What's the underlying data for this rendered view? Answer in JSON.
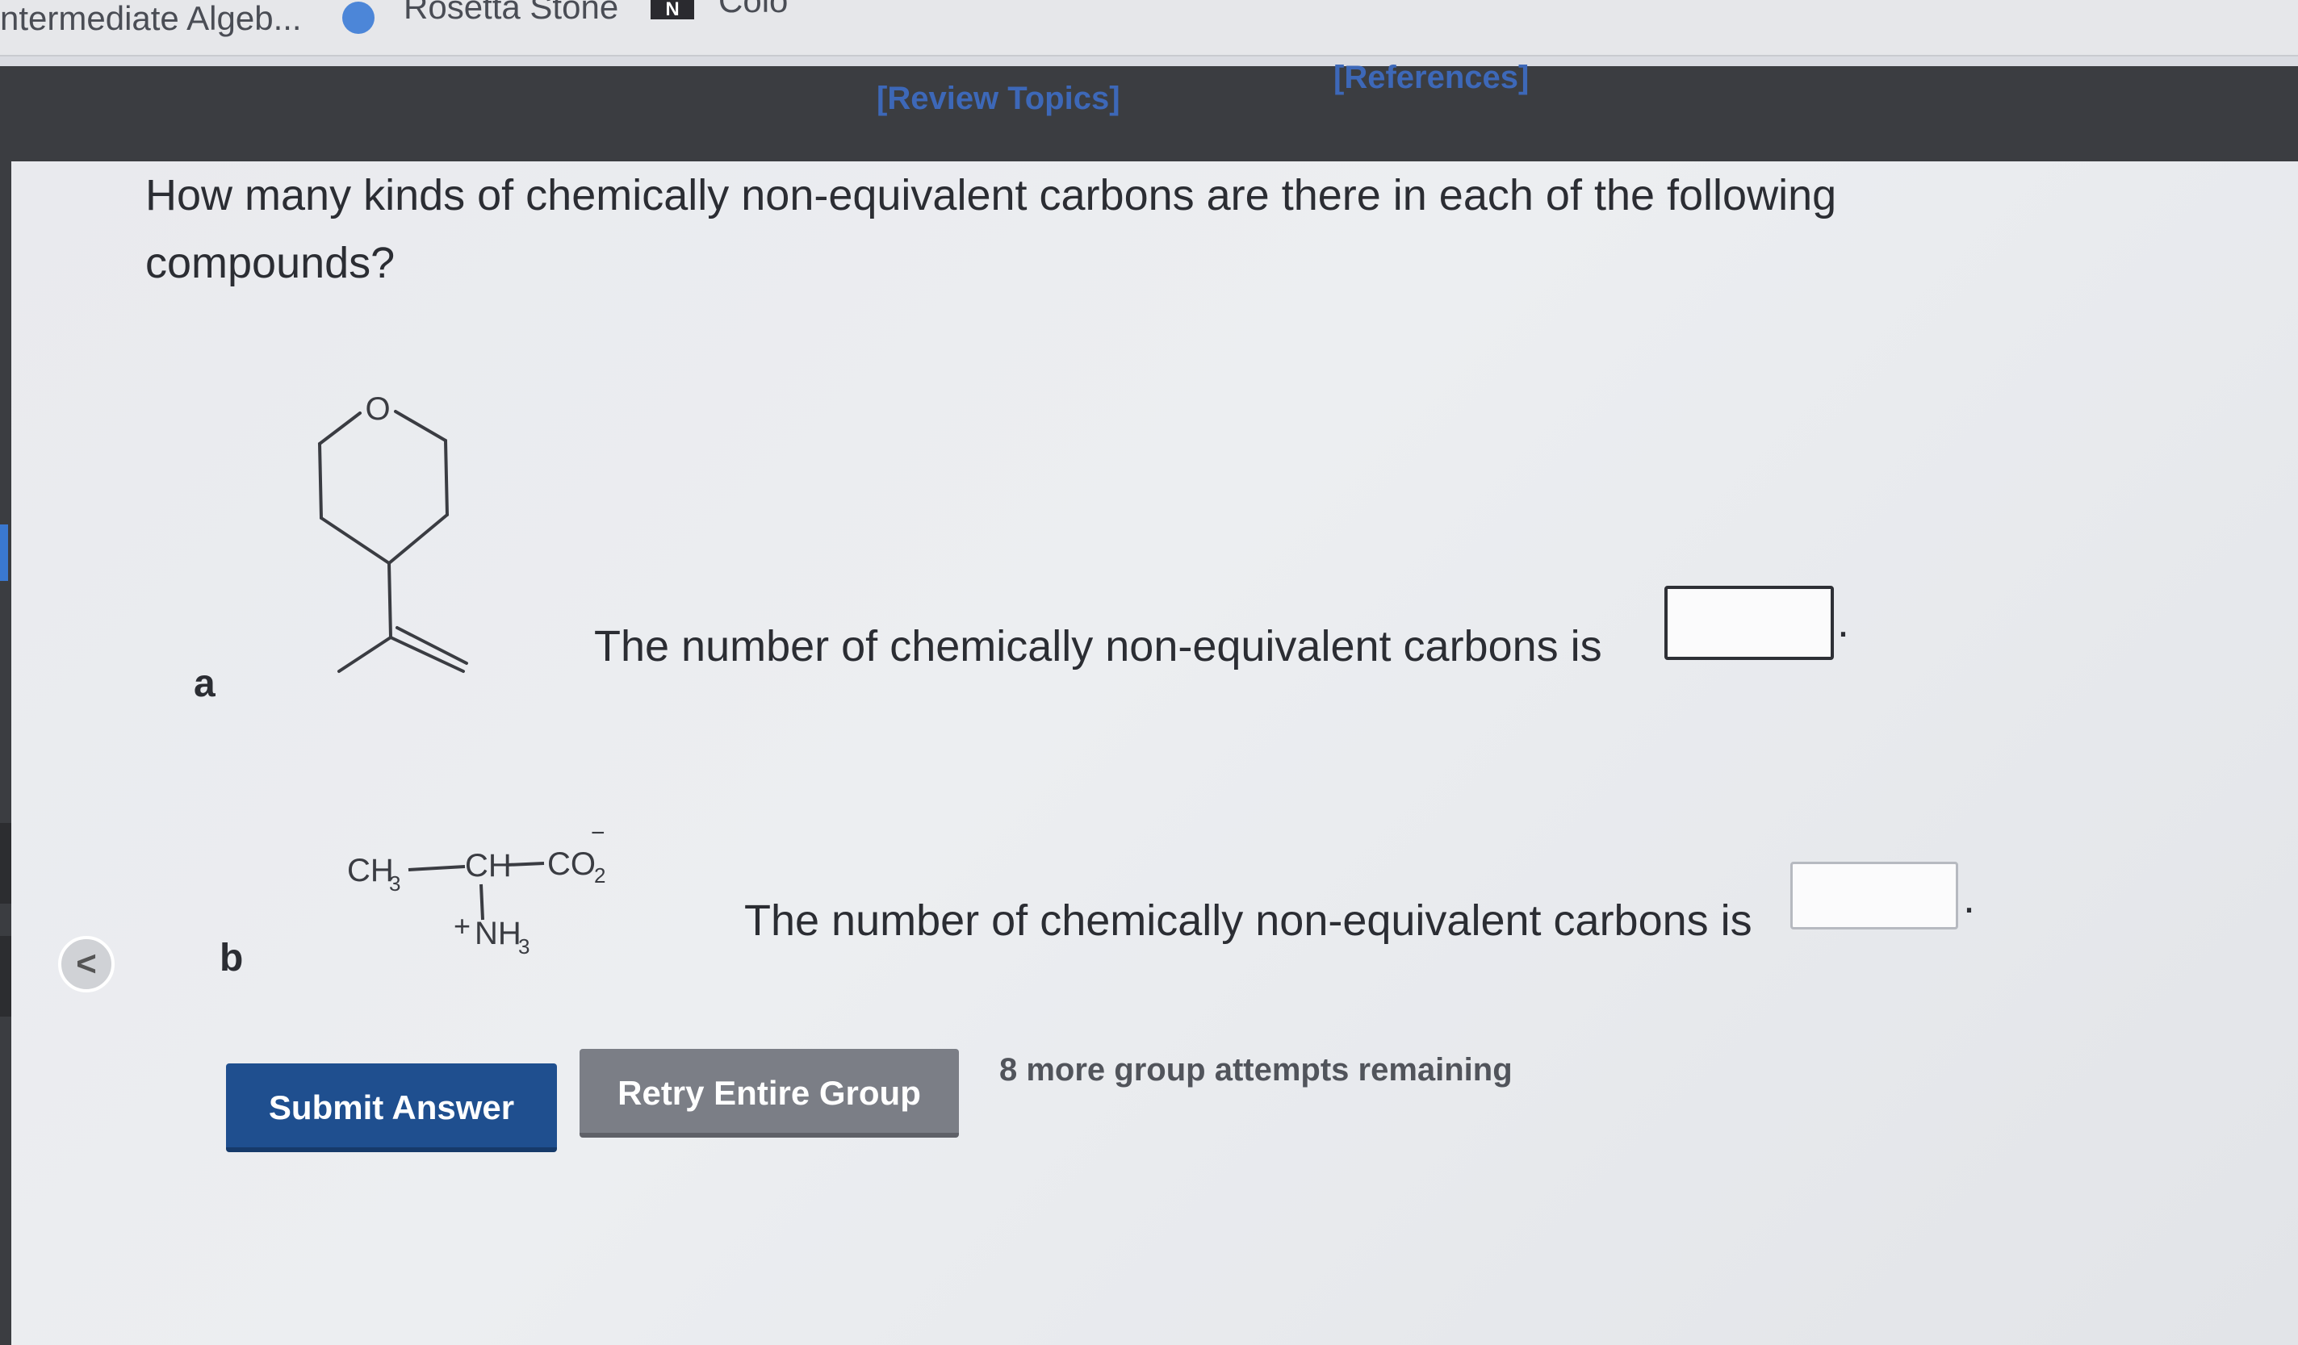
{
  "bookmarks": {
    "item1": "ntermediate Algeb...",
    "item2": "Rosetta Stone",
    "item3": "Colo"
  },
  "header": {
    "review_topics": "[Review Topics]",
    "references": "[References]"
  },
  "question": {
    "text": "How many kinds of chemically non-equivalent carbons are there in each of the following compounds?"
  },
  "parts": [
    {
      "label": "a",
      "prompt": "The number of chemically non-equivalent carbons is",
      "answer": "",
      "period": "."
    },
    {
      "label": "b",
      "prompt": "The number of chemically non-equivalent carbons is",
      "answer": "",
      "period": "."
    }
  ],
  "molecule_a": {
    "oxygen": "O"
  },
  "molecule_b": {
    "ch3": "CH",
    "ch3_sub": "3",
    "ch": "CH",
    "co2": "CO",
    "co2_sub": "2",
    "co2_charge": "−",
    "nh3_charge": "+",
    "nh3": "NH",
    "nh3_sub": "3"
  },
  "actions": {
    "submit_label": "Submit Answer",
    "retry_label": "Retry Entire Group",
    "attempts_text": "8 more group attempts remaining"
  },
  "nav": {
    "collapse_glyph": "<"
  }
}
